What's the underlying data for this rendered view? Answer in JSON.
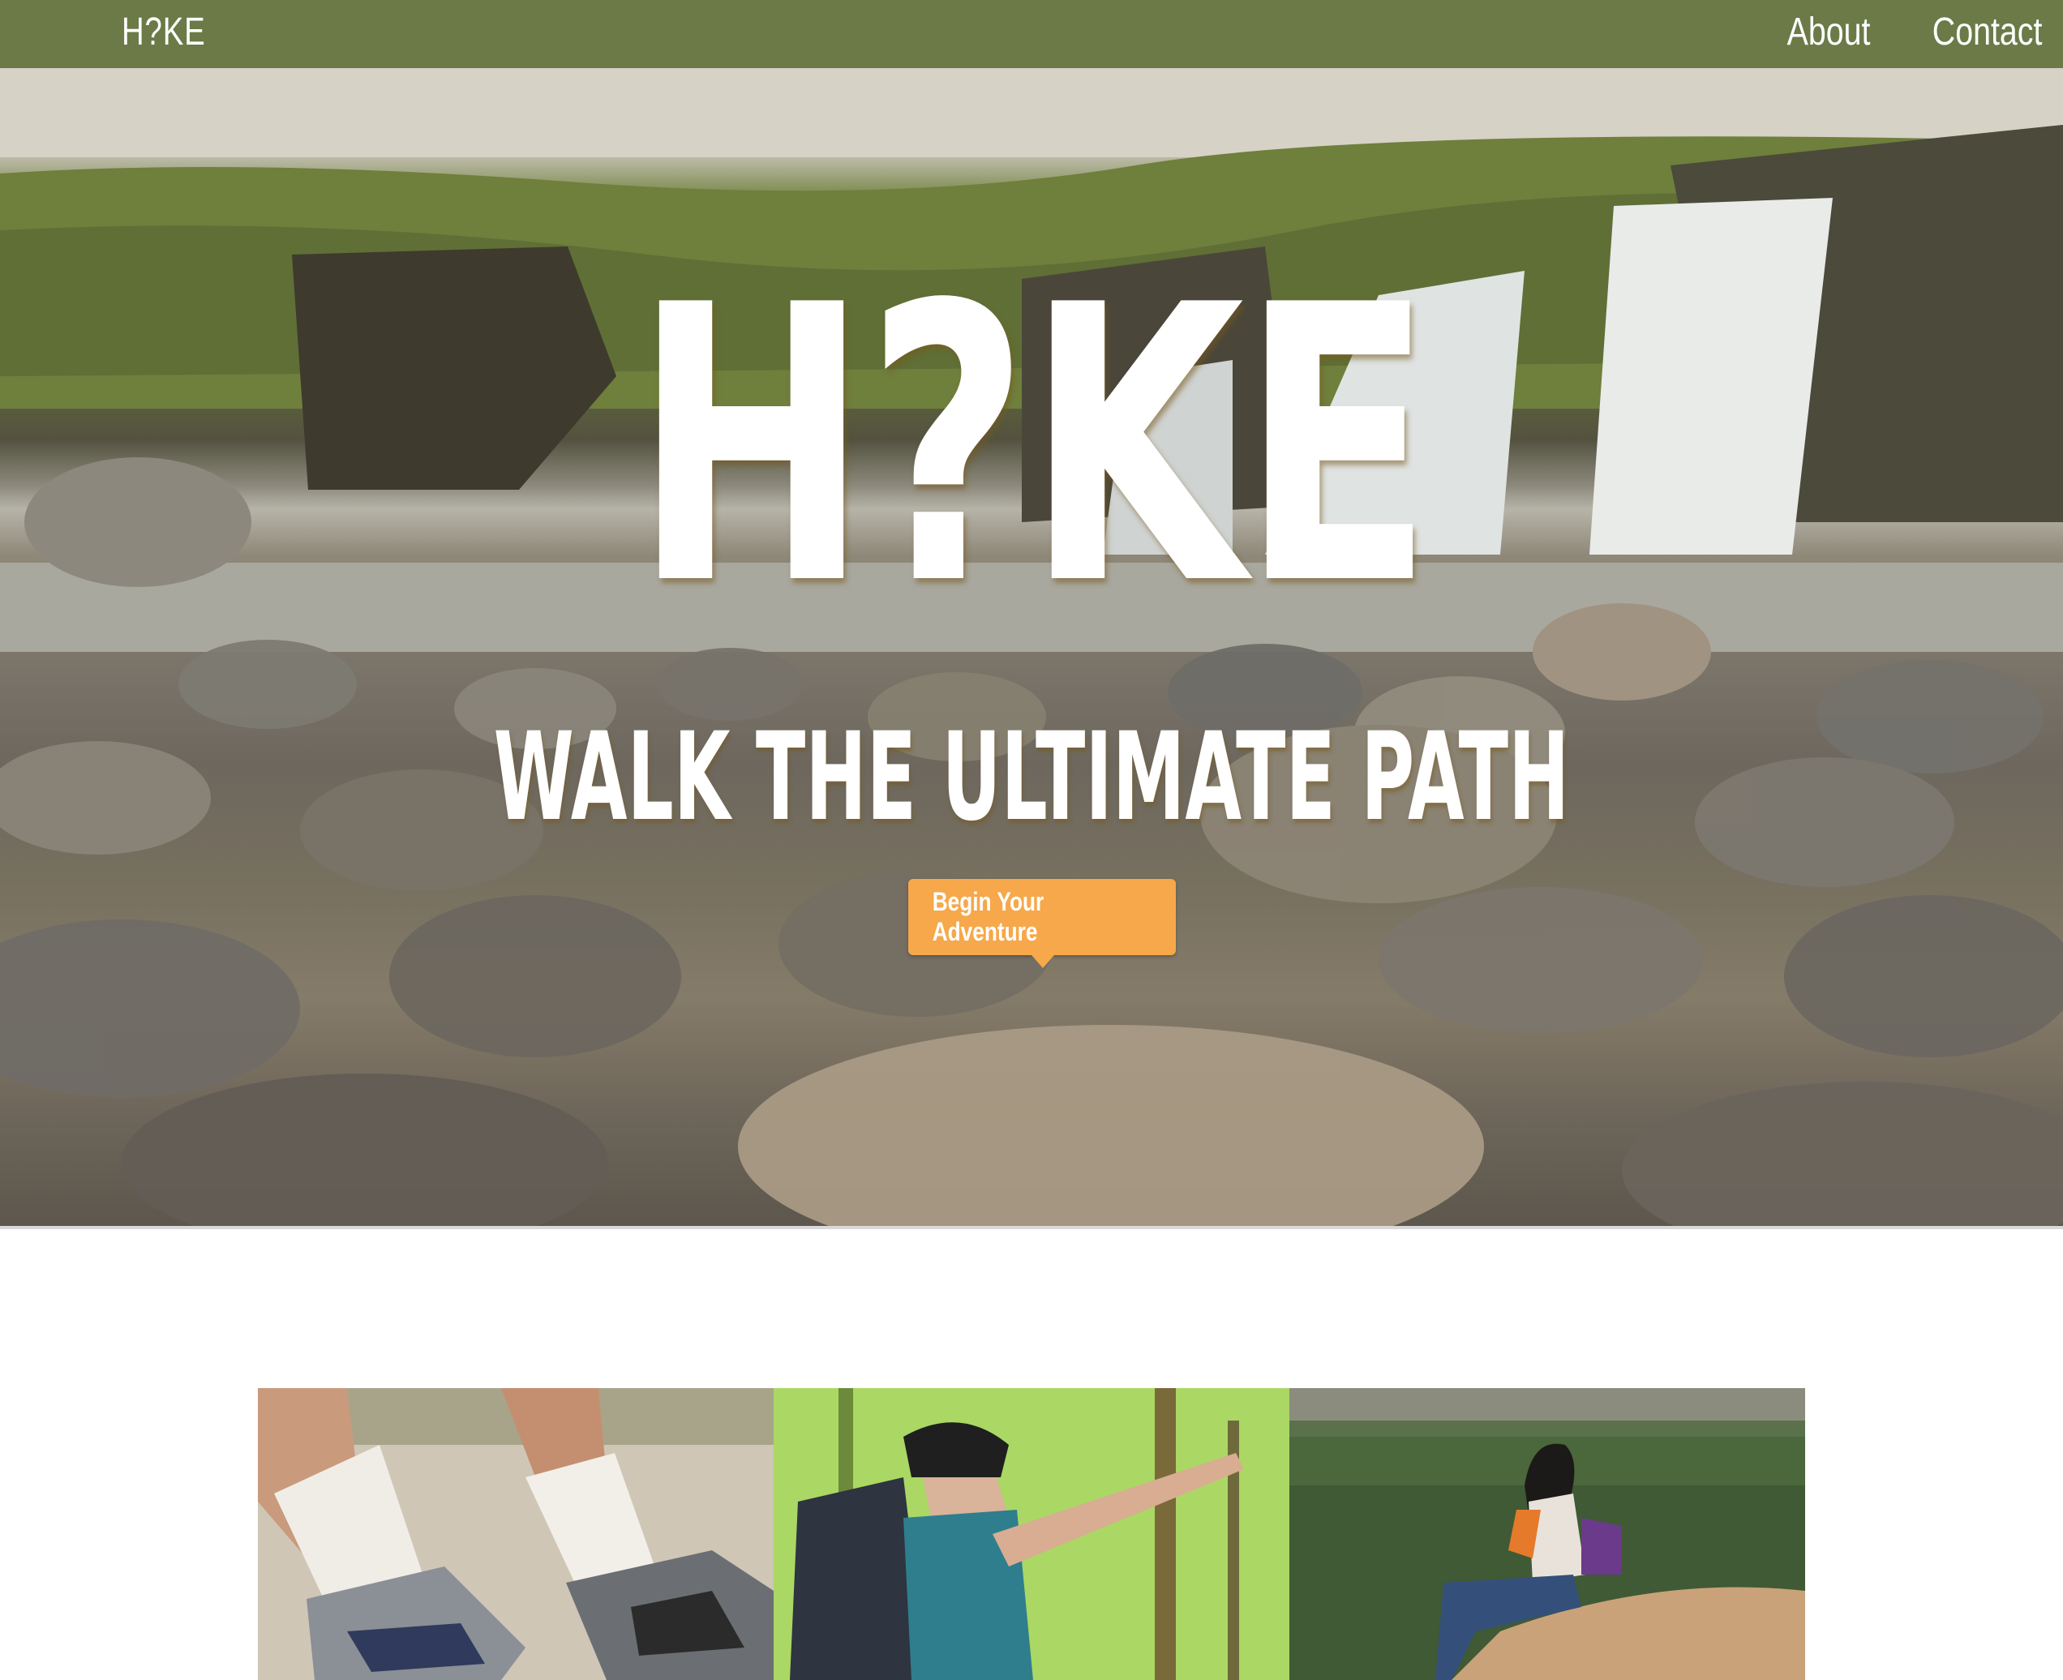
{
  "navbar": {
    "brand": "H?KE",
    "links": [
      "About",
      "Contact"
    ]
  },
  "hero": {
    "title": "H?KE",
    "subtitle": "WALK THE ULTIMATE PATH",
    "cta_label": "Begin Your Adventure"
  },
  "gallery": {
    "items": [
      "hiking-boots-photo",
      "hiker-pointing-photo",
      "hiker-overlook-photo"
    ]
  },
  "colors": {
    "navbar": "#6b7a47",
    "accent": "#f6a84a",
    "text_on_dark": "#ffffff"
  }
}
